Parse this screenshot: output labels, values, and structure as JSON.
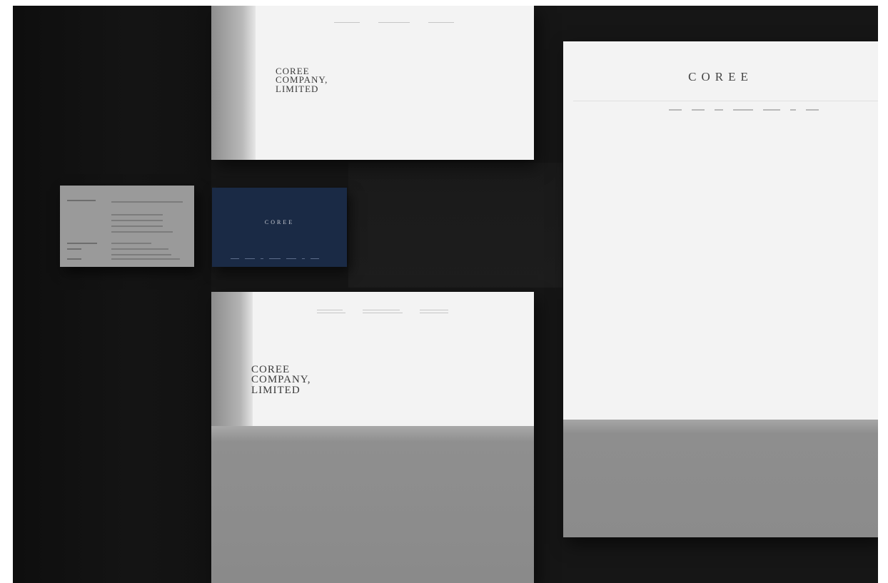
{
  "scene": {
    "background_color": "#161616",
    "paper_color": "#f3f3f3",
    "navy_card_color": "#1a2a45",
    "grey_card_color": "#9a9a9a"
  },
  "envelope_top": {
    "wordmark_lines": [
      "COREE",
      "COMPANY,",
      "LIMITED"
    ]
  },
  "envelope_bottom": {
    "wordmark_lines": [
      "COREE",
      "COMPANY,",
      "LIMITED"
    ]
  },
  "letterhead": {
    "logo": "COREE"
  },
  "business_card_navy": {
    "logo": "COREE"
  }
}
